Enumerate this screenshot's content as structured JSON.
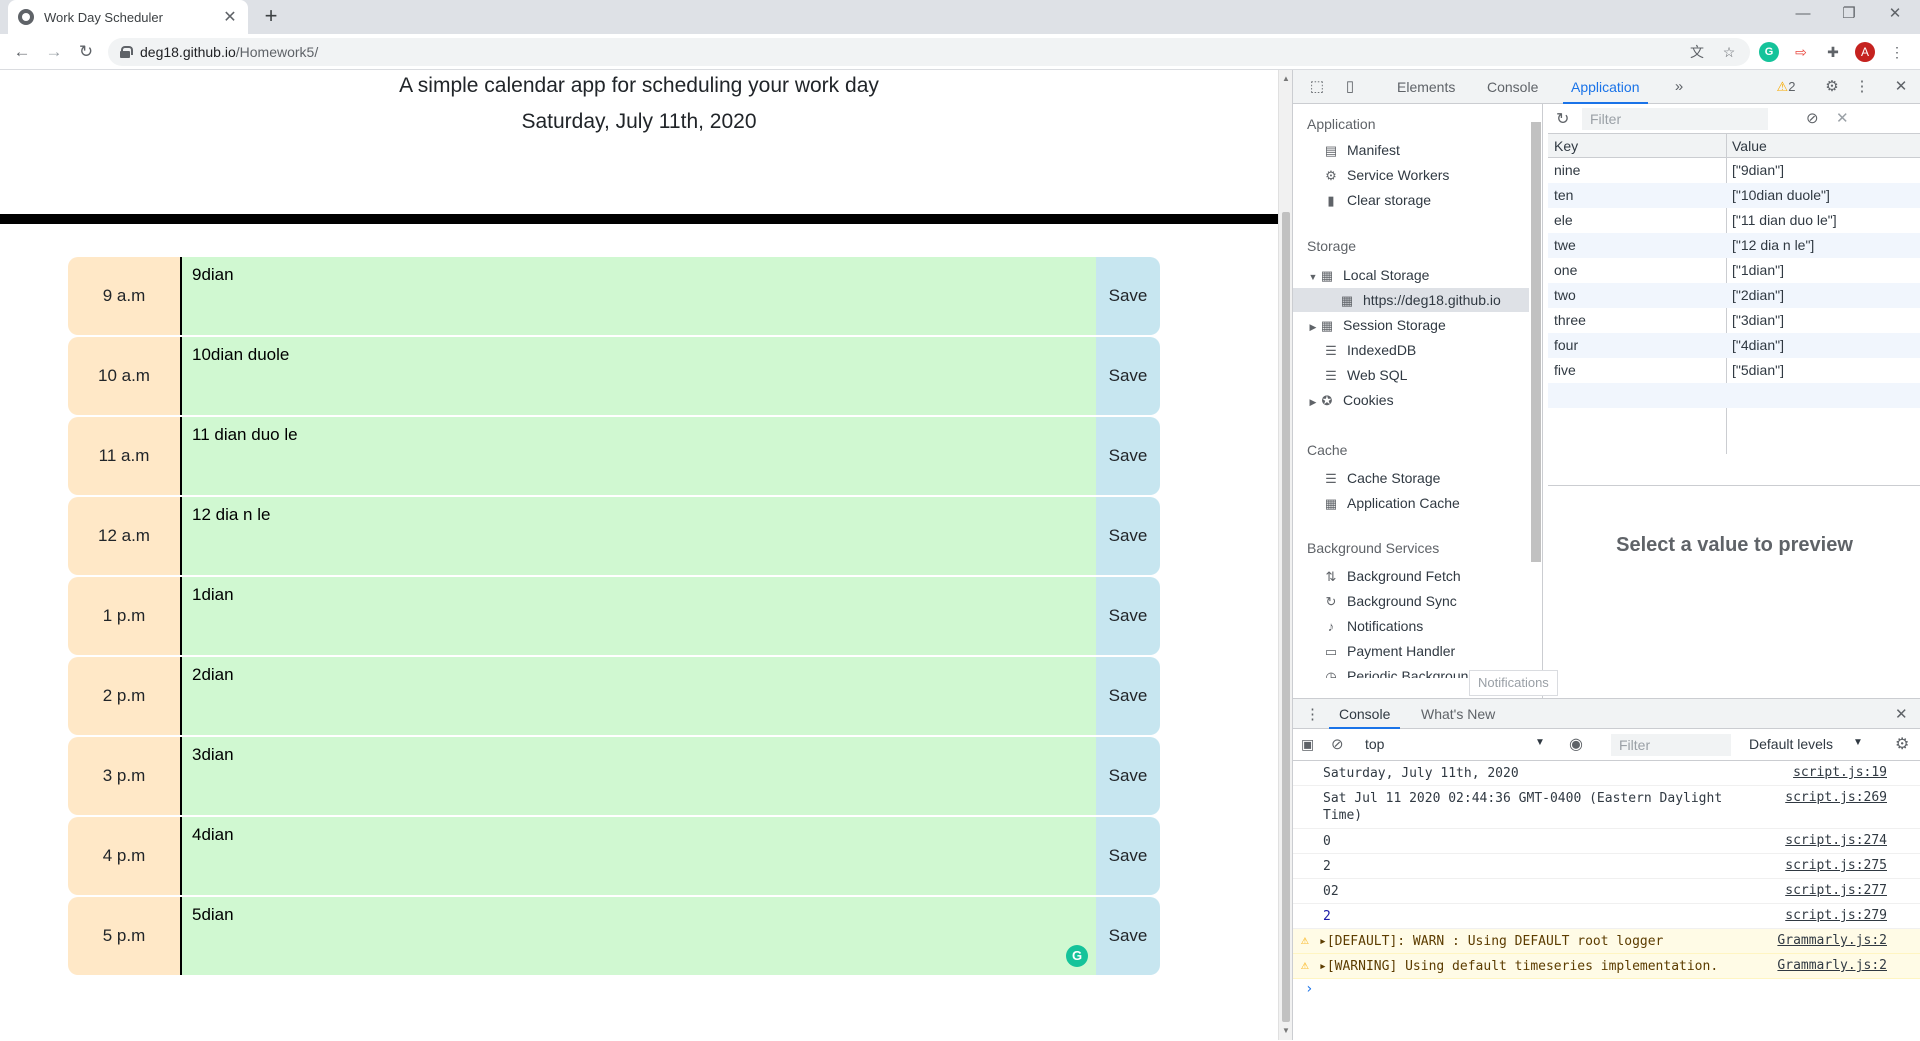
{
  "browser": {
    "tab_title": "Work Day Scheduler",
    "url_host": "deg18.github.io",
    "url_path": "/Homework5/",
    "profile_initial": "A"
  },
  "page": {
    "lead": "A simple calendar app for scheduling your work day",
    "current_day": "Saturday, July 11th, 2020",
    "save_label": "Save",
    "rows": [
      {
        "hour": "9 a.m",
        "text": "9dian"
      },
      {
        "hour": "10 a.m",
        "text": "10dian duole"
      },
      {
        "hour": "11 a.m",
        "text": "11 dian duo le"
      },
      {
        "hour": "12 a.m",
        "text": "12 dia n le"
      },
      {
        "hour": "1 p.m",
        "text": "1dian"
      },
      {
        "hour": "2 p.m",
        "text": "2dian"
      },
      {
        "hour": "3 p.m",
        "text": "3dian"
      },
      {
        "hour": "4 p.m",
        "text": "4dian"
      },
      {
        "hour": "5 p.m",
        "text": "5dian"
      }
    ]
  },
  "devtools": {
    "tabs": {
      "elements": "Elements",
      "console": "Console",
      "application": "Application"
    },
    "warning_count": "2",
    "sidebar": {
      "application_header": "Application",
      "manifest": "Manifest",
      "service_workers": "Service Workers",
      "clear_storage": "Clear storage",
      "storage_header": "Storage",
      "local_storage": "Local Storage",
      "local_storage_origin": "https://deg18.github.io",
      "session_storage": "Session Storage",
      "indexeddb": "IndexedDB",
      "web_sql": "Web SQL",
      "cookies": "Cookies",
      "cache_header": "Cache",
      "cache_storage": "Cache Storage",
      "application_cache": "Application Cache",
      "bg_services_header": "Background Services",
      "background_fetch": "Background Fetch",
      "background_sync": "Background Sync",
      "notifications": "Notifications",
      "payment_handler": "Payment Handler",
      "periodic_background_sync": "Periodic Background Sync"
    },
    "filter_placeholder": "Filter",
    "table_headers": {
      "key": "Key",
      "value": "Value"
    },
    "storage": [
      {
        "key": "nine",
        "value": "[\"9dian\"]"
      },
      {
        "key": "ten",
        "value": "[\"10dian duole\"]"
      },
      {
        "key": "ele",
        "value": "[\"11 dian duo le\"]"
      },
      {
        "key": "twe",
        "value": "[\"12 dia n le\"]"
      },
      {
        "key": "one",
        "value": "[\"1dian\"]"
      },
      {
        "key": "two",
        "value": "[\"2dian\"]"
      },
      {
        "key": "three",
        "value": "[\"3dian\"]"
      },
      {
        "key": "four",
        "value": "[\"4dian\"]"
      },
      {
        "key": "five",
        "value": "[\"5dian\"]"
      }
    ],
    "preview_text": "Select a value to preview",
    "tooltip": "Notifications",
    "drawer": {
      "console_tab": "Console",
      "whats_new_tab": "What's New",
      "context": "top",
      "filter_placeholder": "Filter",
      "levels": "Default levels"
    },
    "logs": [
      {
        "msg": "Saturday, July 11th, 2020",
        "src": "script.js:19"
      },
      {
        "msg": "Sat Jul 11 2020 02:44:36 GMT-0400 (Eastern Daylight Time)",
        "src": "script.js:269"
      },
      {
        "msg": "0",
        "src": "script.js:274"
      },
      {
        "msg": "2",
        "src": "script.js:275"
      },
      {
        "msg": "02",
        "src": "script.js:277"
      },
      {
        "msg": "2",
        "src": "script.js:279"
      },
      {
        "msg": "[DEFAULT]: WARN : Using DEFAULT root logger",
        "src": "Grammarly.js:2"
      },
      {
        "msg": "[WARNING] Using default timeseries implementation.",
        "src": "Grammarly.js:2"
      }
    ]
  }
}
